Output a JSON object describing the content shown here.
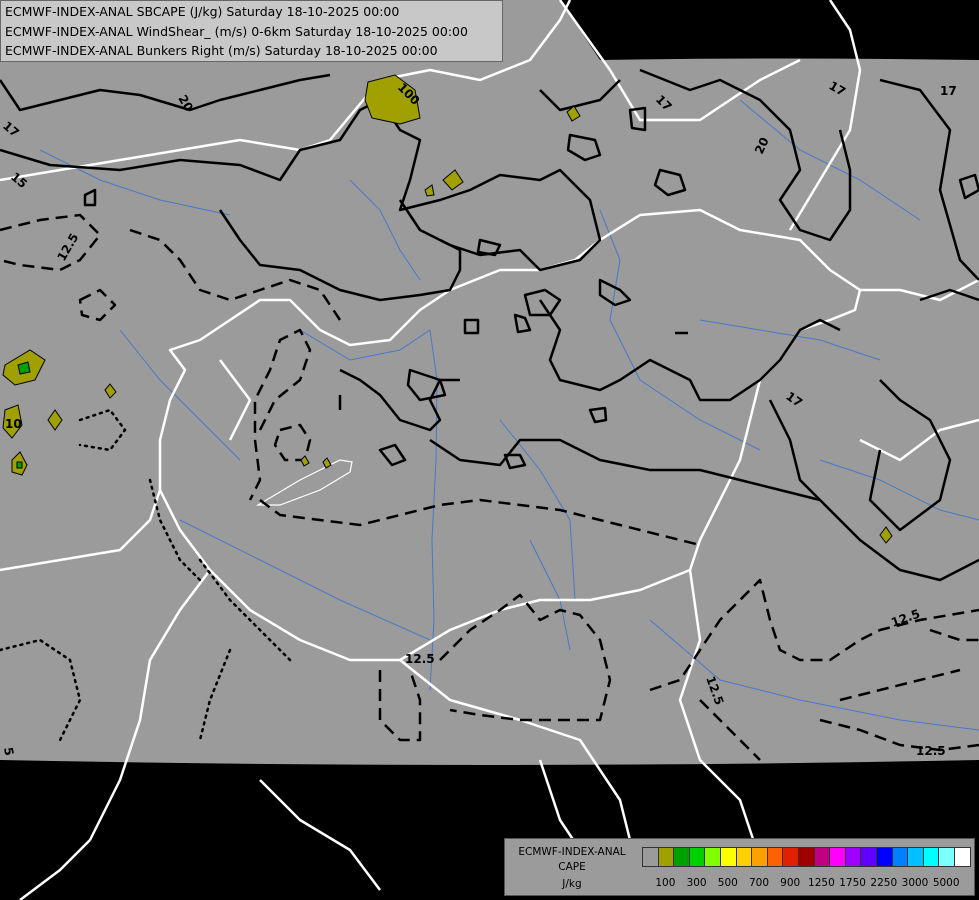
{
  "titles": [
    "ECMWF-INDEX-ANAL SBCAPE (J/kg) Saturday 18-10-2025 00:00",
    "ECMWF-INDEX-ANAL WindShear_ (m/s) 0-6km Saturday 18-10-2025 00:00",
    "ECMWF-INDEX-ANAL Bunkers Right (m/s) Saturday 18-10-2025 00:00"
  ],
  "legend": {
    "title_lines": [
      "ECMWF-INDEX-ANAL",
      "CAPE",
      "J/kg"
    ],
    "colors": [
      "#9b9b9b",
      "#a0a000",
      "#00a000",
      "#00d000",
      "#80ff00",
      "#ffff00",
      "#ffd000",
      "#ffa000",
      "#ff6000",
      "#e02000",
      "#a00000",
      "#c00080",
      "#ff00ff",
      "#a000ff",
      "#6000ff",
      "#0000ff",
      "#0080ff",
      "#00c0ff",
      "#00ffff",
      "#80ffff",
      "#ffffff"
    ],
    "tick_labels": [
      "100",
      "300",
      "500",
      "700",
      "900",
      "1250",
      "1750",
      "2250",
      "3000",
      "5000"
    ]
  },
  "contour_labels": {
    "shear_20_a": "20",
    "shear_20_b": "20",
    "shear_17_a": "17",
    "shear_17_b": "17",
    "shear_17_c": "17",
    "shear_17_d": "17",
    "shear_15": "15",
    "shear_17_e": "17",
    "bunkers_12_5_a": "12.5",
    "bunkers_12_5_b": "12.5",
    "bunkers_12_5_c": "12.5",
    "bunkers_12_5_d": "12.5",
    "bunkers_12_5_e": "12.5",
    "cape_100": "100",
    "cape_10": "10",
    "dotted_5": "5"
  },
  "colors": {
    "map_fill": "#9b9b9b",
    "outside": "#000000",
    "border": "#ffffff",
    "river": "#4a78c8"
  }
}
